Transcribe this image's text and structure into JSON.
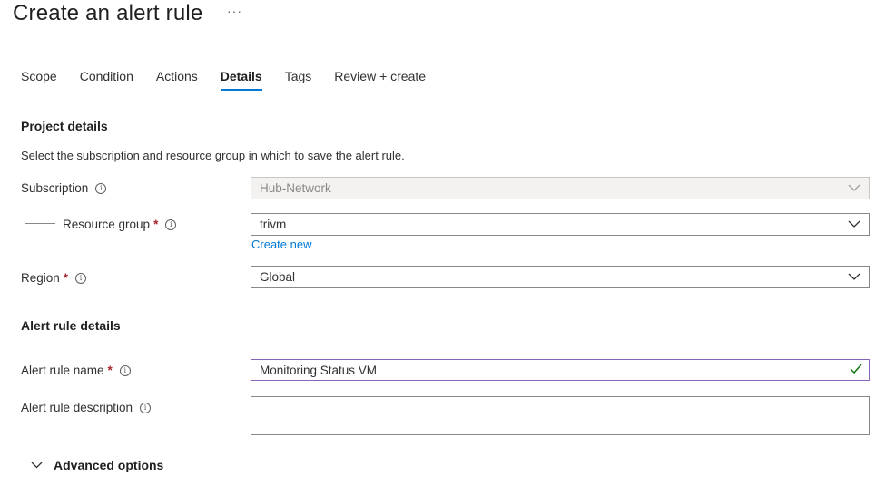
{
  "page": {
    "title": "Create an alert rule",
    "more": "···"
  },
  "tabs": [
    {
      "label": "Scope"
    },
    {
      "label": "Condition"
    },
    {
      "label": "Actions"
    },
    {
      "label": "Details"
    },
    {
      "label": "Tags"
    },
    {
      "label": "Review + create"
    }
  ],
  "active_tab": "Details",
  "project_details": {
    "heading": "Project details",
    "description": "Select the subscription and resource group in which to save the alert rule.",
    "subscription": {
      "label": "Subscription",
      "value": "Hub-Network",
      "disabled": true
    },
    "resource_group": {
      "label": "Resource group",
      "required_mark": "*",
      "value": "trivm",
      "create_new": "Create new"
    },
    "region": {
      "label": "Region",
      "required_mark": "*",
      "value": "Global"
    }
  },
  "alert_rule_details": {
    "heading": "Alert rule details",
    "name": {
      "label": "Alert rule name",
      "required_mark": "*",
      "value": "Monitoring Status VM",
      "valid": true
    },
    "description": {
      "label": "Alert rule description",
      "value": ""
    }
  },
  "advanced": {
    "label": "Advanced options",
    "expanded": false
  },
  "colors": {
    "accent": "#0078d4",
    "focus_border": "#8764b8",
    "valid_check": "#107c10",
    "required": "#a4262c"
  }
}
